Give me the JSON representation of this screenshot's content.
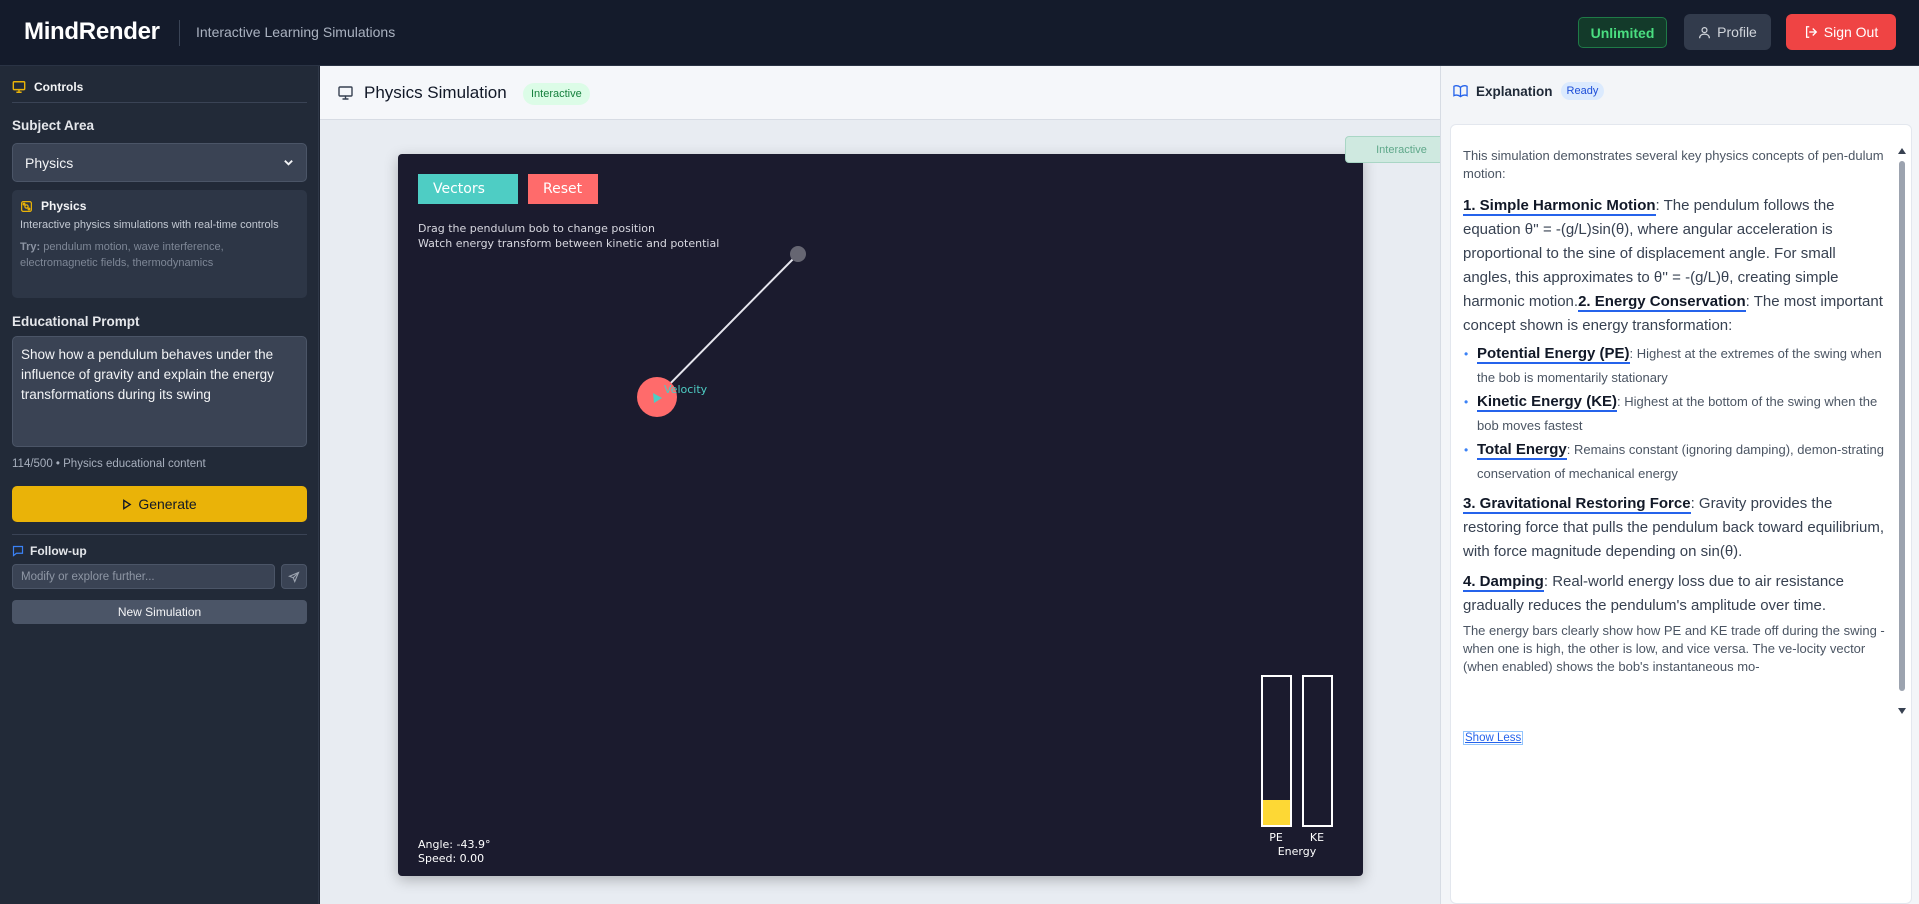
{
  "app": {
    "brand": "MindRender",
    "subtitle": "Interactive Learning Simulations",
    "plan_badge": "Unlimited",
    "profile_label": "Profile",
    "signout_label": "Sign Out"
  },
  "sidebar": {
    "controls_label": "Controls",
    "subject_label": "Subject Area",
    "subject_value": "Physics",
    "subject_card": {
      "title": "Physics",
      "description": "Interactive physics simulations with real-time controls",
      "try_label": "Try:",
      "try_text": " pendulum motion, wave interference, electromagnetic fields, thermodynamics"
    },
    "prompt_label": "Educational Prompt",
    "prompt_value": "Show how a pendulum behaves under the influence of gravity and explain the energy transformations during its swing",
    "char_count": "114/500 • Physics educational content",
    "generate_label": "Generate",
    "followup_label": "Follow-up",
    "followup_placeholder": "Modify or explore further...",
    "new_sim_label": "New Simulation"
  },
  "main": {
    "title": "Physics Simulation",
    "mode_badge": "Interactive",
    "overlay_tag": "Interactive",
    "sim": {
      "vectors_button": "Vectors",
      "reset_button": "Reset",
      "instruction_1": "Drag the pendulum bob to change position",
      "instruction_2": "Watch energy transform between kinetic and potential",
      "velocity_label": "Velocity",
      "angle_readout": "Angle: -43.9°",
      "speed_readout": "Speed: 0.00",
      "pe_label": "PE",
      "ke_label": "KE",
      "energy_label": "Energy",
      "pe_fraction": 0.17,
      "ke_fraction": 0.0,
      "colors": {
        "background": "#1b1b2e",
        "bob": "#ff6b6b",
        "vectors": "#4ecdc4",
        "reset": "#ff6b6b",
        "pe_bar": "#fdd835"
      }
    }
  },
  "explanation": {
    "title": "Explanation",
    "status": "Ready",
    "intro": "This simulation demonstrates several key physics concepts of pen-dulum motion:",
    "shm_term": "1. Simple Harmonic Motion",
    "shm_text": ": The pendulum follows the equation θ'' = -(g/L)sin(θ), where angular acceleration is proportional to the sine of displacement angle. For small angles, this approximates to θ'' = -(g/L)θ, creating simple harmonic motion.",
    "energy_term": "2. Energy Conservation",
    "energy_text": ": The most important concept shown is energy transformation:",
    "pe_term": "Potential Energy (PE)",
    "pe_text": ": Highest at the extremes of the swing when the bob is momentarily stationary",
    "ke_term": "Kinetic Energy (KE)",
    "ke_text": ": Highest at the bottom of the swing when the bob moves fastest",
    "total_term": "Total Energy",
    "total_text": ": Remains constant (ignoring damping), demon-strating conservation of mechanical energy",
    "grav_term": "3. Gravitational Restoring Force",
    "grav_text": ": Gravity provides the restoring force that pulls the pendulum back toward equilibrium, with force magnitude depending on sin(θ).",
    "damp_term": "4. Damping",
    "damp_text": ": Real-world energy loss due to air resistance gradually reduces the pendulum's amplitude over time.",
    "bars_text": "The energy bars clearly show how PE and KE trade off during the swing - when one is high, the other is low, and vice versa. The ve-locity vector (when enabled) shows the bob's instantaneous mo-",
    "show_less": "Show Less"
  }
}
